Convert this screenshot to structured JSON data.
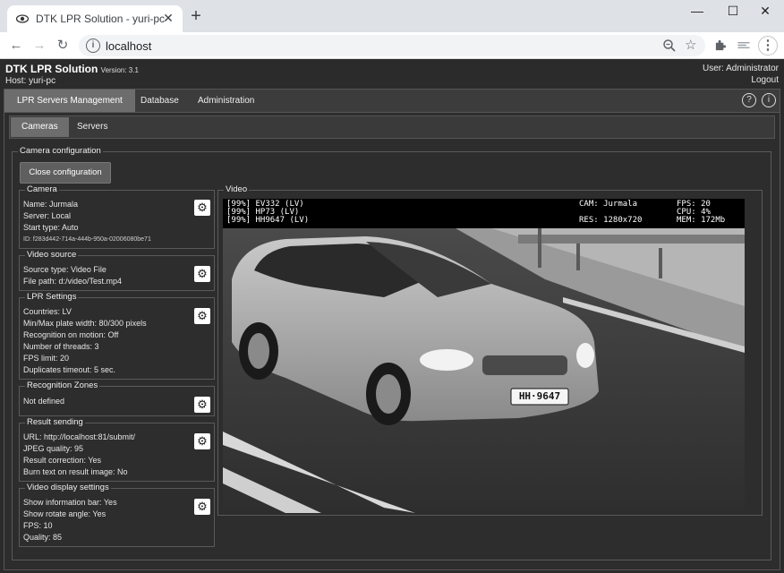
{
  "browser": {
    "tab_title": "DTK LPR Solution - yuri-pc",
    "tab_close": "✕",
    "new_tab": "+",
    "url": "localhost",
    "window_controls": {
      "minimize": "—",
      "maximize": "☐",
      "close": "✕"
    }
  },
  "app": {
    "title": "DTK LPR Solution",
    "version": "Version: 3.1",
    "host": "Host: yuri-pc",
    "user": "User: Administrator",
    "logout": "Logout"
  },
  "main_tabs": [
    "LPR Servers Management",
    "Database",
    "Administration"
  ],
  "sub_tabs": [
    "Cameras",
    "Servers"
  ],
  "camera_config": {
    "legend": "Camera configuration",
    "close_button": "Close configuration"
  },
  "sections": {
    "camera": {
      "legend": "Camera",
      "name": "Name: Jurmala",
      "server": "Server: Local",
      "start_type": "Start type: Auto",
      "id": "ID: f283d442-714a-444b-950a-02006080be71"
    },
    "video_source": {
      "legend": "Video source",
      "source_type": "Source type: Video File",
      "file_path": "File path: d:/video/Test.mp4"
    },
    "lpr_settings": {
      "legend": "LPR Settings",
      "countries": "Countries: LV",
      "plate_width": "Min/Max plate width: 80/300 pixels",
      "recognition_motion": "Recognition on motion: Off",
      "threads": "Number of threads: 3",
      "fps_limit": "FPS limit: 20",
      "duplicates_timeout": "Duplicates timeout: 5 sec."
    },
    "recognition_zones": {
      "legend": "Recognition Zones",
      "value": "Not defined"
    },
    "result_sending": {
      "legend": "Result sending",
      "url": "URL: http://localhost:81/submit/",
      "jpeg_quality": "JPEG quality: 95",
      "result_correction": "Result correction: Yes",
      "burn_text": "Burn text on result image: No"
    },
    "video_display": {
      "legend": "Video display settings",
      "show_info_bar": "Show information bar: Yes",
      "show_rotate": "Show rotate angle: Yes",
      "fps": "FPS: 10",
      "quality": "Quality: 85"
    }
  },
  "video": {
    "legend": "Video",
    "plates": [
      "[99%] EV332 (LV)",
      "[99%] HP73 (LV)",
      "[99%] HH9647 (LV)"
    ],
    "cam": "CAM: Jurmala",
    "res": "RES: 1280x720",
    "fps": "FPS: 20",
    "cpu": "CPU: 4%",
    "mem": "MEM: 172Mb",
    "plate_text": "HH·9647"
  }
}
